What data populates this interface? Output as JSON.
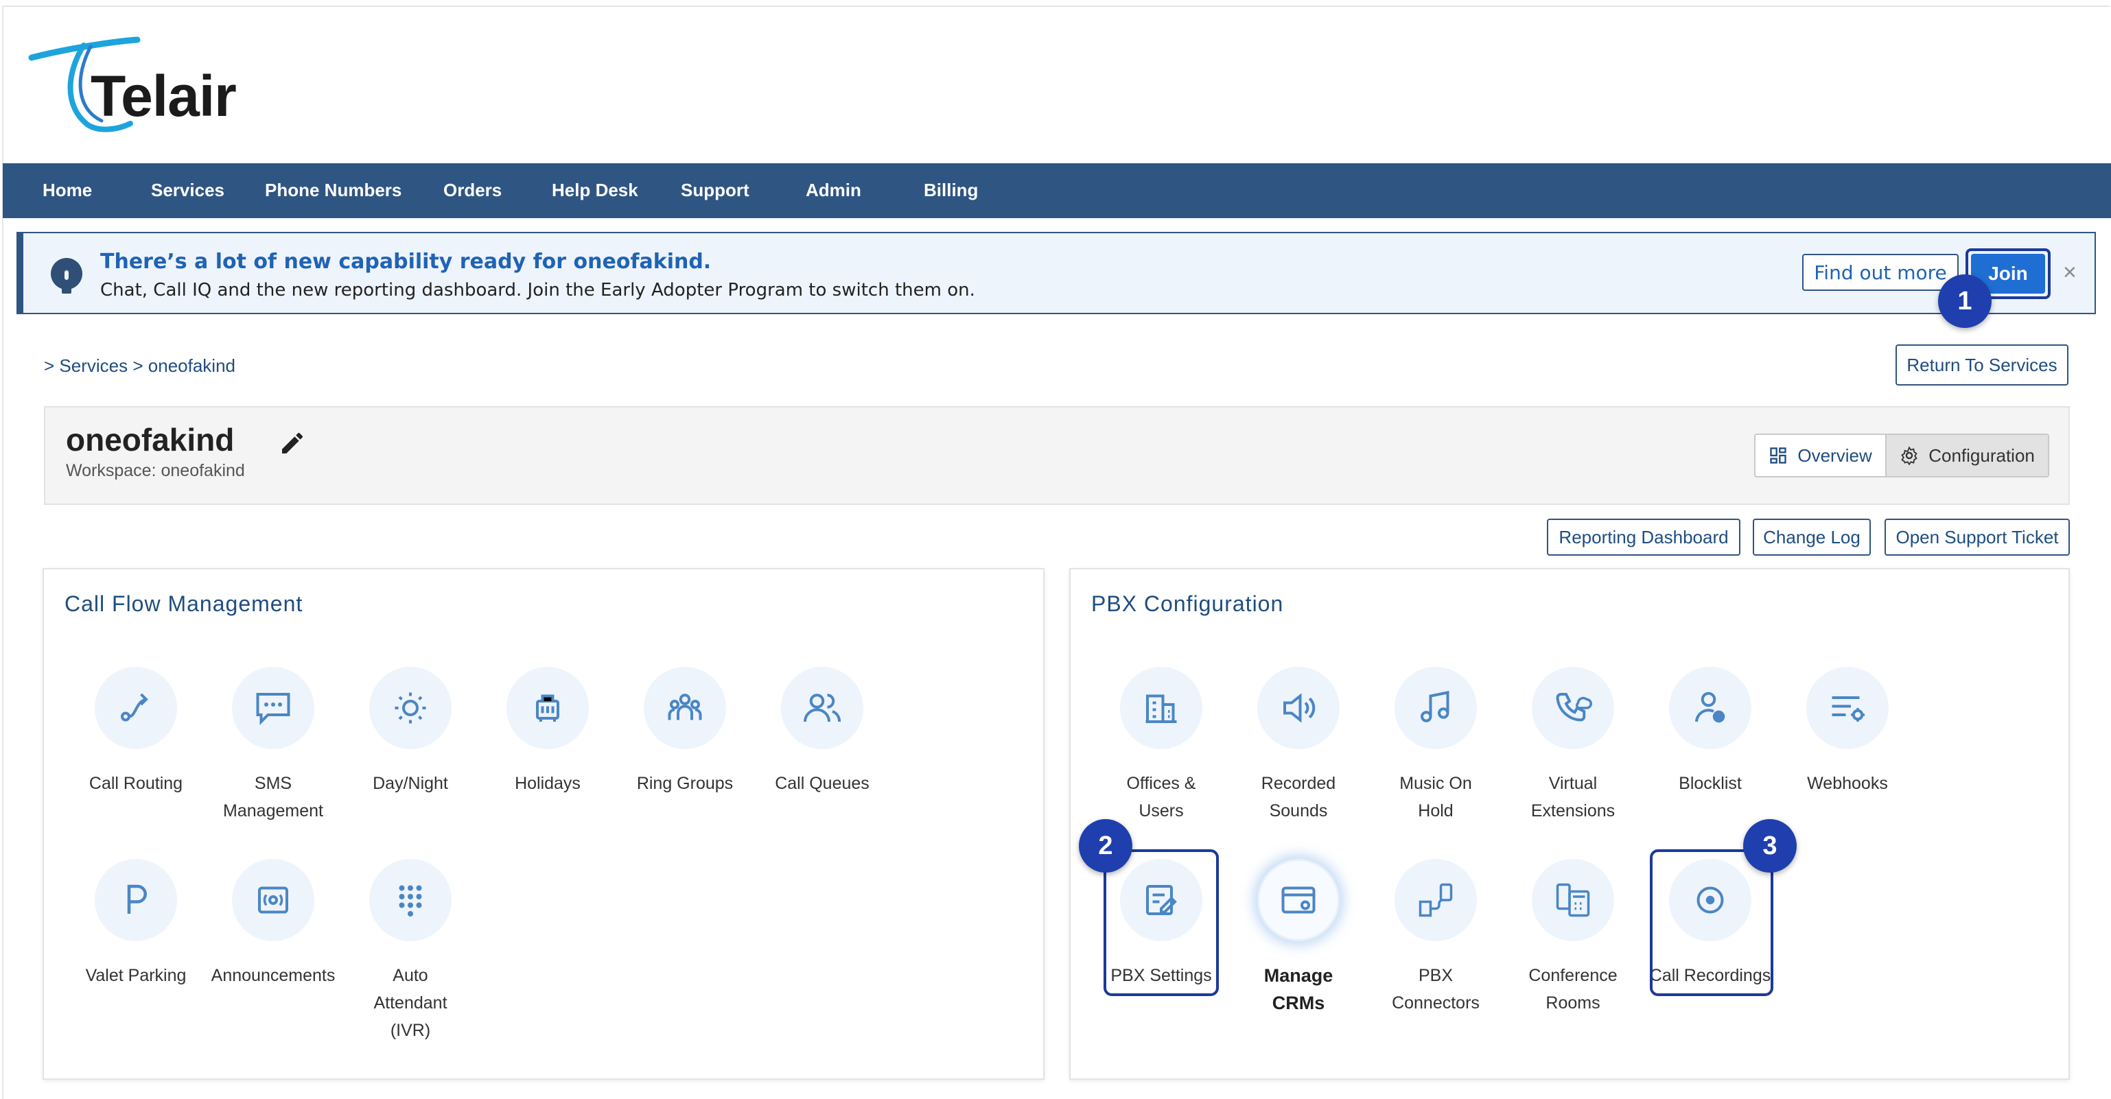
{
  "brand": {
    "name": "Telair"
  },
  "nav": [
    "Home",
    "Services",
    "Phone Numbers",
    "Orders",
    "Help Desk",
    "Support",
    "Admin",
    "Billing"
  ],
  "banner": {
    "title": "There’s a lot of new capability ready for oneofakind.",
    "subtitle": "Chat, Call IQ and the new reporting dashboard. Join the Early Adopter Program to switch them on.",
    "find_out_more": "Find out more",
    "join": "Join",
    "close": "×"
  },
  "badges": [
    "1",
    "2",
    "3"
  ],
  "breadcrumb": {
    "sep1": ">",
    "services": "Services",
    "sep2": ">",
    "current": "oneofakind"
  },
  "return_button": "Return To Services",
  "workspace": {
    "name": "oneofakind",
    "subtitle": "Workspace: oneofakind",
    "overview": "Overview",
    "configuration": "Configuration"
  },
  "actions": [
    "Reporting Dashboard",
    "Change Log",
    "Open Support Ticket"
  ],
  "call_flow": {
    "title": "Call Flow Management",
    "tiles": [
      {
        "label1": "Call Routing",
        "label2": "",
        "label3": "",
        "icon": "route-icon"
      },
      {
        "label1": "SMS",
        "label2": "Management",
        "label3": "",
        "icon": "sms-icon"
      },
      {
        "label1": "Day/Night",
        "label2": "",
        "label3": "",
        "icon": "day-night-icon"
      },
      {
        "label1": "Holidays",
        "label2": "",
        "label3": "",
        "icon": "holidays-icon"
      },
      {
        "label1": "Ring Groups",
        "label2": "",
        "label3": "",
        "icon": "ring-groups-icon"
      },
      {
        "label1": "Call Queues",
        "label2": "",
        "label3": "",
        "icon": "call-queues-icon"
      },
      {
        "label1": "Valet Parking",
        "label2": "",
        "label3": "",
        "icon": "parking-icon"
      },
      {
        "label1": "Announcements",
        "label2": "",
        "label3": "",
        "icon": "announcements-icon"
      },
      {
        "label1": "Auto",
        "label2": "Attendant",
        "label3": "(IVR)",
        "icon": "keypad-icon"
      }
    ]
  },
  "pbx": {
    "title": "PBX Configuration",
    "tiles": [
      {
        "label1": "Offices &",
        "label2": "Users",
        "icon": "offices-icon"
      },
      {
        "label1": "Recorded",
        "label2": "Sounds",
        "icon": "speaker-icon"
      },
      {
        "label1": "Music On",
        "label2": "Hold",
        "icon": "music-icon"
      },
      {
        "label1": "Virtual",
        "label2": "Extensions",
        "icon": "virtual-extension-icon"
      },
      {
        "label1": "Blocklist",
        "label2": "",
        "icon": "blocklist-icon"
      },
      {
        "label1": "Webhooks",
        "label2": "",
        "icon": "webhooks-icon"
      },
      {
        "label1": "PBX Settings",
        "label2": "",
        "icon": "pbx-settings-icon"
      },
      {
        "label1": "Manage",
        "label2": "CRMs",
        "icon": "crm-icon"
      },
      {
        "label1": "PBX",
        "label2": "Connectors",
        "icon": "connectors-icon"
      },
      {
        "label1": "Conference",
        "label2": "Rooms",
        "icon": "conference-icon"
      },
      {
        "label1": "Call Recordings",
        "label2": "",
        "icon": "record-icon"
      }
    ]
  },
  "colors": {
    "nav_bg": "#2f5583",
    "accent": "#1f63b5",
    "highlight": "#1b3a9a",
    "icon": "#4a86c5",
    "tile_bg": "#eef4fb"
  }
}
